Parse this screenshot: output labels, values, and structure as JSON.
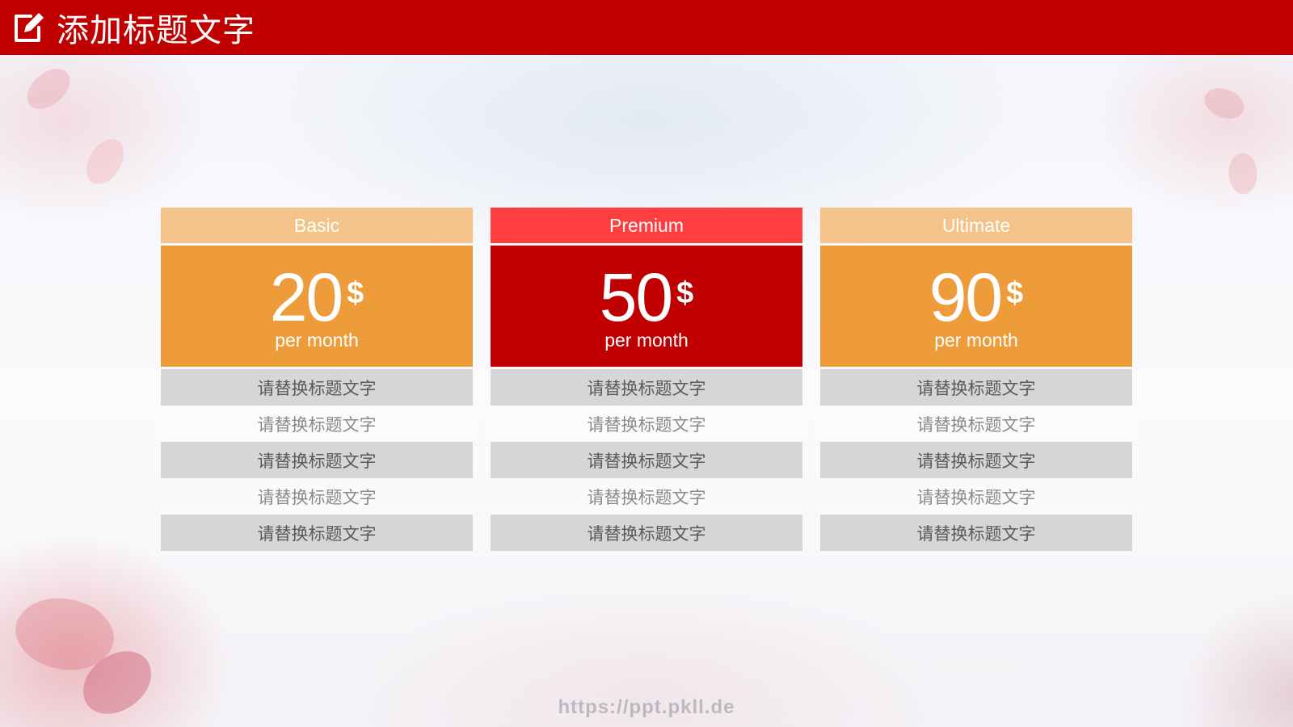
{
  "header": {
    "title": "添加标题文字",
    "bar_color": "#c00000",
    "icon": "edit-icon"
  },
  "plans": [
    {
      "name": "Basic",
      "price": "20",
      "currency": "$",
      "period": "per month",
      "head_color": "#f3c389",
      "body_color": "#ee9b3a",
      "features": [
        "请替换标题文字",
        "请替换标题文字",
        "请替换标题文字",
        "请替换标题文字",
        "请替换标题文字"
      ]
    },
    {
      "name": "Premium",
      "price": "50",
      "currency": "$",
      "period": "per month",
      "head_color": "#ff3f3f",
      "body_color": "#c00000",
      "features": [
        "请替换标题文字",
        "请替换标题文字",
        "请替换标题文字",
        "请替换标题文字",
        "请替换标题文字"
      ]
    },
    {
      "name": "Ultimate",
      "price": "90",
      "currency": "$",
      "period": "per month",
      "head_color": "#f3c389",
      "body_color": "#ee9b3a",
      "features": [
        "请替换标题文字",
        "请替换标题文字",
        "请替换标题文字",
        "请替换标题文字",
        "请替换标题文字"
      ]
    }
  ],
  "footer": {
    "url": "https://ppt.pkll.de"
  }
}
